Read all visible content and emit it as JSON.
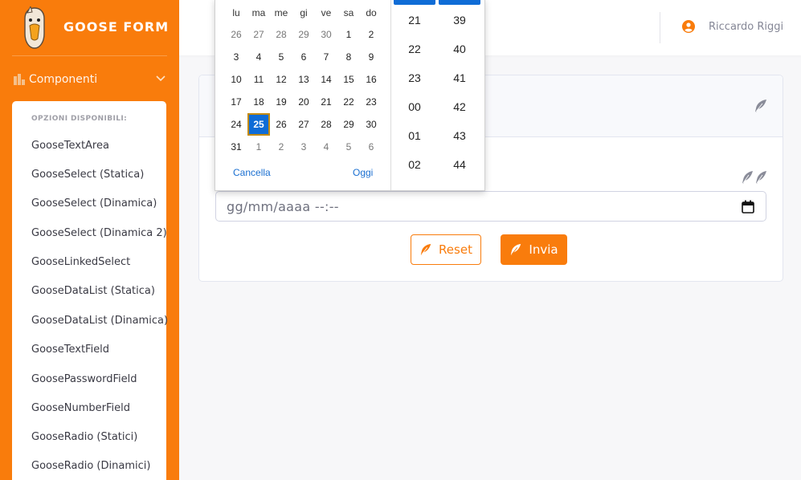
{
  "brand": {
    "name": "GOOSE FORM"
  },
  "sidebar": {
    "menu_label": "Componenti",
    "submenu_header": "OPZIONI DISPONIBILI:",
    "items": [
      "GooseTextArea",
      "GooseSelect (Statica)",
      "GooseSelect (Dinamica)",
      "GooseSelect (Dinamica 2)",
      "GooseLinkedSelect",
      "GooseDataList (Statica)",
      "GooseDataList (Dinamica)",
      "GooseTextField",
      "GoosePasswordField",
      "GooseNumberField",
      "GooseRadio (Statici)",
      "GooseRadio (Dinamici)"
    ]
  },
  "topbar": {
    "user_name": "Riccardo Riggi"
  },
  "form": {
    "date_placeholder": "gg/mm/aaaa --:--",
    "reset_label": "Reset",
    "send_label": "Invia"
  },
  "picker": {
    "weekdays": [
      "lu",
      "ma",
      "me",
      "gi",
      "ve",
      "sa",
      "do"
    ],
    "weeks": [
      [
        "26",
        "27",
        "28",
        "29",
        "30",
        "1",
        "2"
      ],
      [
        "3",
        "4",
        "5",
        "6",
        "7",
        "8",
        "9"
      ],
      [
        "10",
        "11",
        "12",
        "13",
        "14",
        "15",
        "16"
      ],
      [
        "17",
        "18",
        "19",
        "20",
        "21",
        "22",
        "23"
      ],
      [
        "24",
        "25",
        "26",
        "27",
        "28",
        "29",
        "30"
      ],
      [
        "31",
        "1",
        "2",
        "3",
        "4",
        "5",
        "6"
      ]
    ],
    "selected_day": "25",
    "cancel_label": "Cancella",
    "today_label": "Oggi",
    "hours": [
      "21",
      "22",
      "23",
      "00",
      "01",
      "02"
    ],
    "minutes": [
      "39",
      "40",
      "41",
      "42",
      "43",
      "44"
    ]
  },
  "colors": {
    "brand_orange": "#f97c0c",
    "picker_blue": "#0f6cd6"
  },
  "icons": {
    "logo": "goose-logo-icon",
    "components": "chart-bar-icon",
    "chevron": "chevron-down-icon",
    "user": "user-circle-icon",
    "feather": "feather-icon",
    "calendar": "calendar-icon"
  }
}
